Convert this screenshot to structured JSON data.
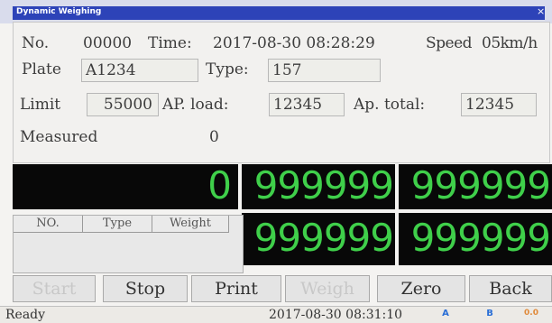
{
  "window": {
    "title": "Dynamic Weighing",
    "close_glyph": "×"
  },
  "header": {
    "no_label": "No.",
    "no_value": "00000",
    "time_label": "Time:",
    "time_value": "2017-08-30 08:28:29",
    "speed_label": "Speed",
    "speed_value": "05km/h"
  },
  "form": {
    "plate_label": "Plate",
    "plate_value": "A1234",
    "type_label": "Type:",
    "type_value": "157",
    "limit_label": "Limit",
    "limit_value": "55000",
    "ap_load_label": "AP. load:",
    "ap_load_value": "12345",
    "ap_total_label": "Ap. total:",
    "ap_total_value": "12345",
    "measured_label": "Measured",
    "measured_value": "0"
  },
  "displays": {
    "main_weight": "0",
    "d1": "999999",
    "d2": "999999",
    "d3": "999999",
    "d4": "999999"
  },
  "list": {
    "columns": [
      "NO.",
      "Type",
      "Weight"
    ]
  },
  "buttons": {
    "start": "Start",
    "stop": "Stop",
    "print": "Print",
    "weigh": "Weigh",
    "zero": "Zero",
    "back": "Back"
  },
  "status": {
    "state": "Ready",
    "datetime": "2017-08-30 08:31:10",
    "indicator_a": "A",
    "indicator_b": "B",
    "indicator_c": "0.0"
  },
  "colors": {
    "lcd_green": "#3fcf4a",
    "title_blue": "#2d43b8",
    "indicator_blue": "#2a6fd6",
    "indicator_orange": "#e08a3a"
  },
  "icons": [
    "close-icon",
    "signal-a-icon",
    "signal-b-icon",
    "signal-c-icon"
  ]
}
